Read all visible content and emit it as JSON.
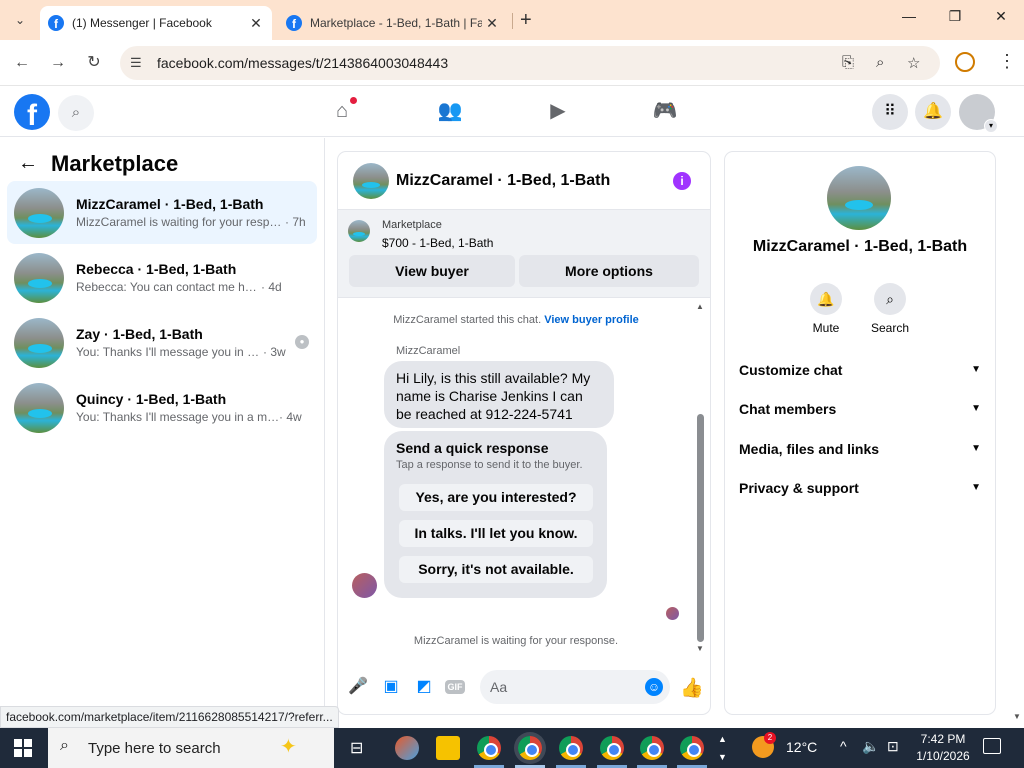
{
  "browser": {
    "tabs": [
      {
        "title": "(1) Messenger | Facebook",
        "active": true
      },
      {
        "title": "Marketplace - 1-Bed, 1-Bath | Fa",
        "active": false
      }
    ],
    "new_tab_glyph": "+",
    "url": "facebook.com/messages/t/2143864003048443",
    "window_controls": {
      "minimize": "—",
      "restore": "❐",
      "close": "✕"
    },
    "icons": [
      "tab-search-icon",
      "back-icon",
      "forward-icon",
      "reload-icon",
      "site-info-icon",
      "install-icon",
      "zoom-icon",
      "bookmark-star-icon",
      "profile-icon",
      "menu-icon"
    ]
  },
  "fb_header": {
    "logo": "f",
    "nav_icons": [
      "home-icon",
      "friends-icon",
      "watch-icon",
      "gaming-icon"
    ],
    "notification_dot_color": "#e41e3f",
    "brand_color": "#1877f2"
  },
  "left_panel": {
    "title": "Marketplace",
    "conversations": [
      {
        "name": "MizzCaramel · 1-Bed, 1-Bath",
        "preview": "MizzCaramel is waiting for your respo...",
        "time": "· 7h",
        "selected": true
      },
      {
        "name": "Rebecca · 1-Bed, 1-Bath",
        "preview": "Rebecca: You can contact me here.",
        "time": "· 4d",
        "selected": false
      },
      {
        "name": "Zay · 1-Bed, 1-Bath",
        "preview": "You: Thanks I'll message you in a ...",
        "time": "· 3w",
        "selected": false
      },
      {
        "name": "Quincy · 1-Bed, 1-Bath",
        "preview": "You: Thanks I'll message you in a mo...",
        "time": "· 4w",
        "selected": false
      }
    ]
  },
  "chat": {
    "title": "MizzCaramel · 1-Bed, 1-Bath",
    "listing": {
      "source": "Marketplace",
      "price_line": "$700 - 1-Bed, 1-Bath"
    },
    "buttons": {
      "view_buyer": "View buyer",
      "more_options": "More options"
    },
    "started_text": "MizzCaramel started this chat.",
    "buyer_profile_link": "View buyer profile",
    "sender_name": "MizzCaramel",
    "message": "Hi Lily, is this still available? My name is Charise Jenkins I can be reached at 912-224-5741",
    "quick_response": {
      "title": "Send a quick response",
      "subtitle": "Tap a response to send it to the buyer.",
      "options": [
        "Yes, are you interested?",
        "In talks. I'll let you know.",
        "Sorry, it's not available."
      ]
    },
    "waiting_text": "MizzCaramel is waiting for your response.",
    "composer_placeholder": "Aa",
    "accent_color": "#0084ff"
  },
  "right_panel": {
    "name": "MizzCaramel · 1-Bed, 1-Bath",
    "actions": [
      {
        "label": "Mute",
        "icon": "bell-icon"
      },
      {
        "label": "Search",
        "icon": "search-icon"
      }
    ],
    "sections": [
      "Customize chat",
      "Chat members",
      "Media, files and links",
      "Privacy & support"
    ]
  },
  "status_url": "facebook.com/marketplace/item/2116628085514217/?referr...",
  "taskbar": {
    "search_placeholder": "Type here to search",
    "weather": "12°C",
    "weather_badge": "2",
    "time": "7:42 PM",
    "date": "1/10/2026"
  }
}
